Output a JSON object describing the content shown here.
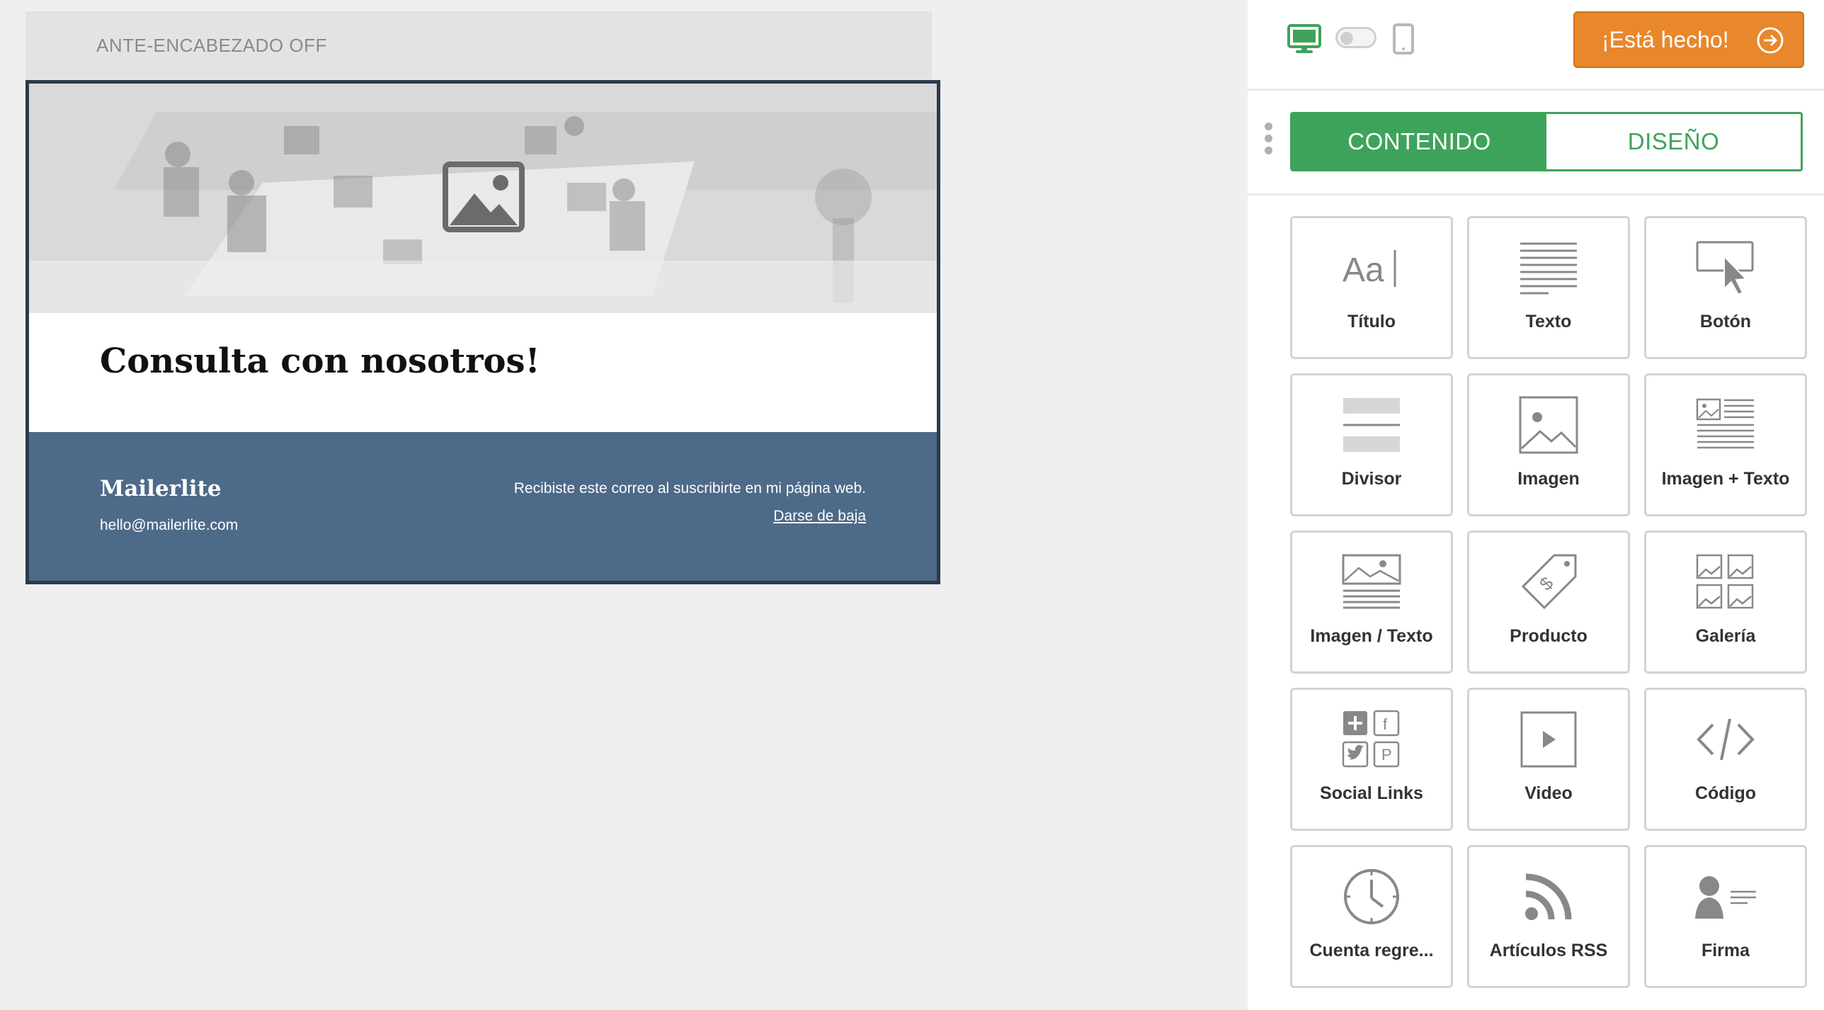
{
  "canvas": {
    "preheader_label": "ANTE-ENCABEZADO OFF",
    "hero": {
      "icon": "image-placeholder-icon"
    },
    "heading": "Consulta con nosotros!",
    "footer": {
      "brand": "Mailerlite",
      "email": "hello@mailerlite.com",
      "notice": "Recibiste este correo al suscribirte en mi página web.",
      "unsubscribe": "Darse de baja"
    }
  },
  "sidebar": {
    "devices": {
      "desktop_icon": "desktop-icon",
      "mobile_icon": "mobile-icon",
      "active": "desktop"
    },
    "done_button": "¡Está hecho!",
    "tabs": [
      {
        "label": "CONTENIDO",
        "active": true
      },
      {
        "label": "DISEÑO",
        "active": false
      }
    ],
    "blocks": [
      {
        "label": "Título",
        "icon": "title-icon"
      },
      {
        "label": "Texto",
        "icon": "text-icon"
      },
      {
        "label": "Botón",
        "icon": "button-icon"
      },
      {
        "label": "Divisor",
        "icon": "divider-icon"
      },
      {
        "label": "Imagen",
        "icon": "image-icon"
      },
      {
        "label": "Imagen + Texto",
        "icon": "image-plus-text-icon"
      },
      {
        "label": "Imagen / Texto",
        "icon": "image-over-text-icon"
      },
      {
        "label": "Producto",
        "icon": "product-tag-icon"
      },
      {
        "label": "Galería",
        "icon": "gallery-icon"
      },
      {
        "label": "Social Links",
        "icon": "social-links-icon"
      },
      {
        "label": "Video",
        "icon": "video-icon"
      },
      {
        "label": "Código",
        "icon": "code-icon"
      },
      {
        "label": "Cuenta regre...",
        "icon": "countdown-clock-icon"
      },
      {
        "label": "Artículos RSS",
        "icon": "rss-icon"
      },
      {
        "label": "Firma",
        "icon": "signature-icon"
      }
    ]
  },
  "colors": {
    "accent_green": "#3ea35a",
    "accent_orange": "#e8872b",
    "footer_blue": "#4e6a89",
    "email_border": "#2c3a4d"
  }
}
